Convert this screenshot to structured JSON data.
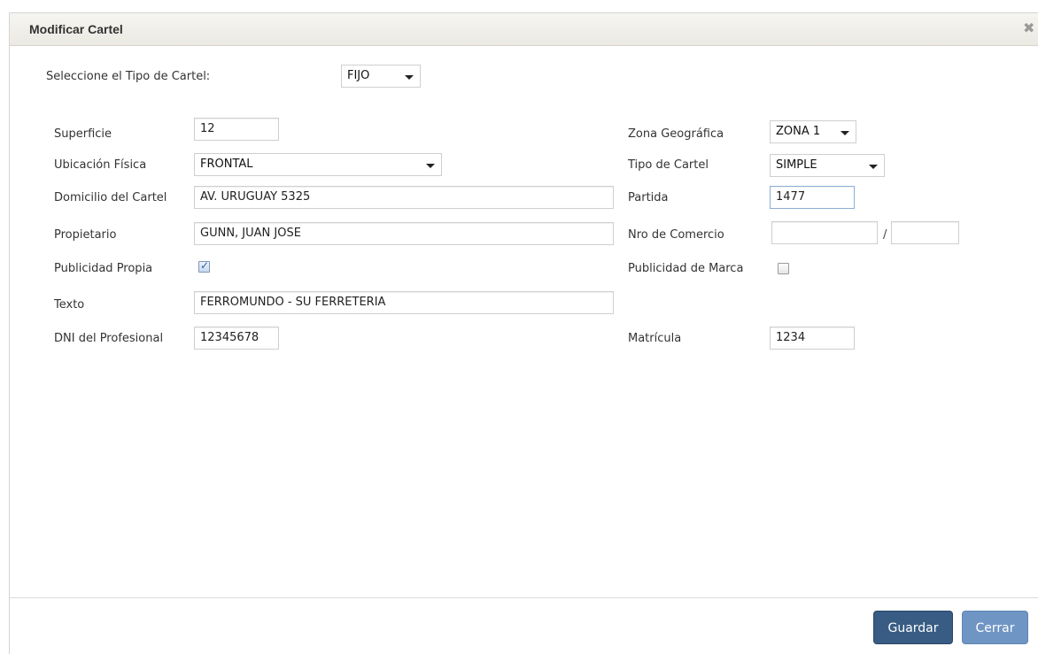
{
  "dialog": {
    "title": "Modificar Cartel",
    "close_icon": "close-icon"
  },
  "tipo_cartel": {
    "label": "Seleccione el Tipo de Cartel:",
    "value": "FIJO"
  },
  "fields": {
    "superficie": {
      "label": "Superficie",
      "value": "12"
    },
    "ubicacion": {
      "label": "Ubicación Física",
      "value": "FRONTAL"
    },
    "domicilio": {
      "label": "Domicilio del Cartel",
      "value": "AV. URUGUAY 5325"
    },
    "propietario": {
      "label": "Propietario",
      "value": "GUNN, JUAN JOSE"
    },
    "publicidad_propia": {
      "label": "Publicidad Propia",
      "checked": true
    },
    "texto": {
      "label": "Texto",
      "value": "FERROMUNDO - SU FERRETERIA"
    },
    "dni": {
      "label": "DNI del Profesional",
      "value": "12345678"
    },
    "zona": {
      "label": "Zona Geográfica",
      "value": "ZONA 1"
    },
    "tipo": {
      "label": "Tipo de Cartel",
      "value": "SIMPLE"
    },
    "partida": {
      "label": "Partida",
      "value": "1477"
    },
    "nro_comercio": {
      "label": "Nro de Comercio",
      "value_a": "",
      "value_b": "",
      "separator": "/"
    },
    "publicidad_marca": {
      "label": "Publicidad de Marca",
      "checked": false
    },
    "matricula": {
      "label": "Matrícula",
      "value": "1234"
    }
  },
  "buttons": {
    "guardar": "Guardar",
    "cerrar": "Cerrar"
  },
  "colors": {
    "primary": "#385c84",
    "secondary": "#6f95c4"
  }
}
